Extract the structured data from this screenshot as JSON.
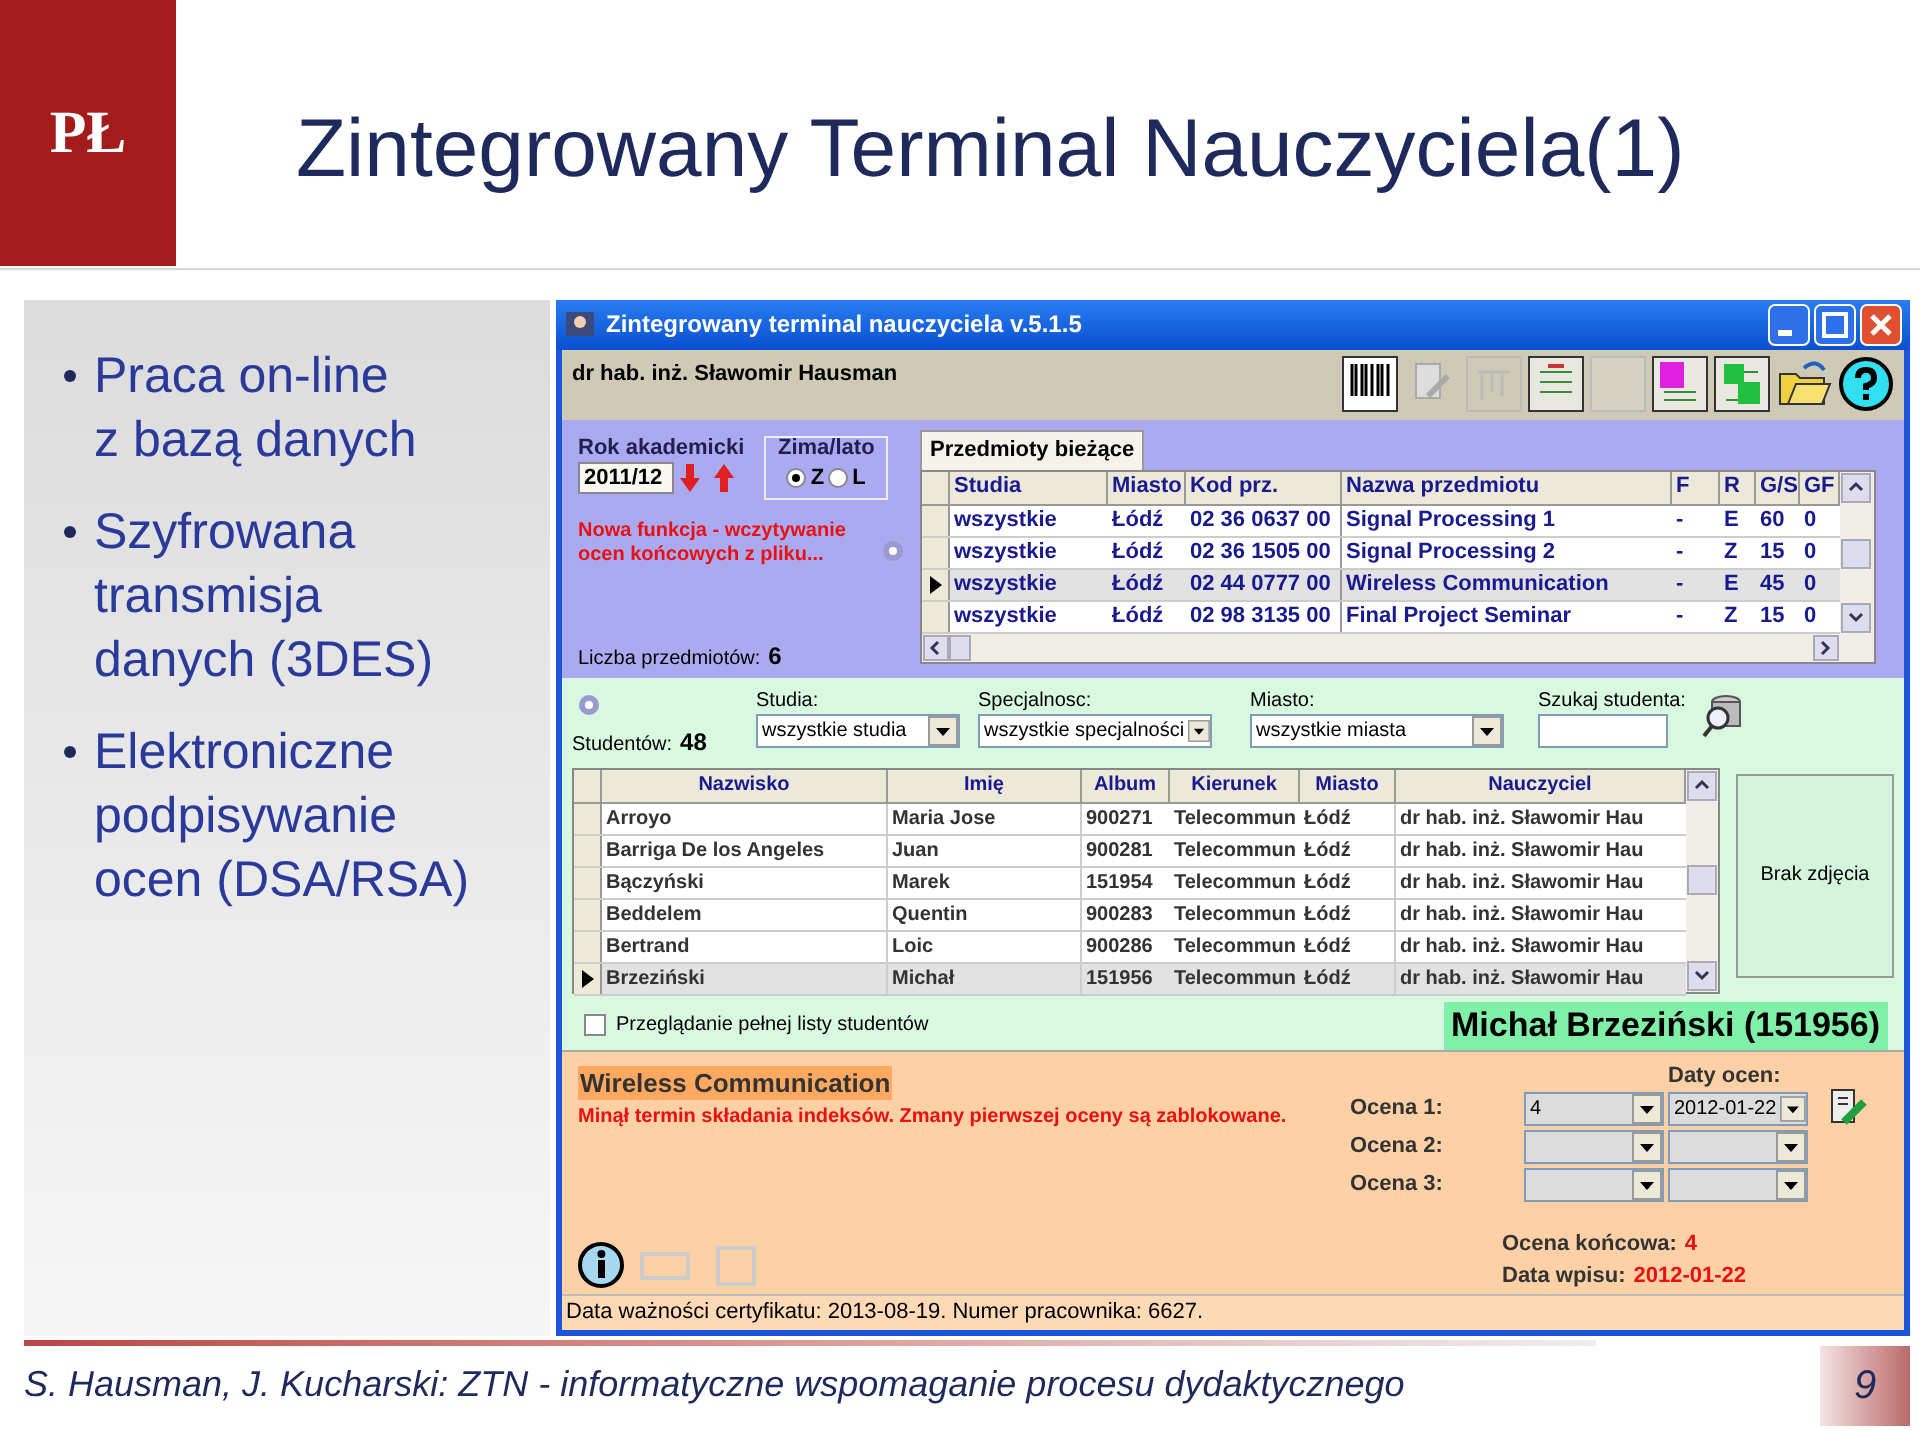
{
  "slide": {
    "logo_text": "PŁ",
    "title": "Zintegrowany Terminal Nauczyciela(1)",
    "bullets": [
      {
        "lines": [
          "Praca on-line",
          "z bazą danych"
        ]
      },
      {
        "lines": [
          "Szyfrowana",
          "transmisja",
          "danych (3DES)"
        ]
      },
      {
        "lines": [
          "Elektroniczne",
          "podpisywanie",
          "ocen (DSA/RSA)"
        ]
      }
    ],
    "footer": "S. Hausman, J. Kucharski: ZTN - informatyczne wspomaganie procesu dydaktycznego",
    "page_number": "9"
  },
  "app": {
    "window": {
      "title": "Zintegrowany terminal nauczyciela v.5.1.5"
    },
    "user_name": "dr hab. inż. Sławomir Hausman",
    "academic_year": {
      "label": "Rok akademicki",
      "value": "2011/12"
    },
    "semester": {
      "label": "Zima/lato",
      "options": [
        {
          "label": "Z",
          "selected": true
        },
        {
          "label": "L",
          "selected": false
        }
      ]
    },
    "notice": "Nowa funkcja - wczytywanie ocen końcowych z pliku...",
    "subjects_count": {
      "label": "Liczba przedmiotów:",
      "value": "6"
    },
    "tabs": [
      {
        "label": "Przedmioty bieżące",
        "selected": true
      }
    ],
    "subjects": {
      "columns": [
        "Studia",
        "Miasto",
        "Kod prz.",
        "Nazwa przedmiotu",
        "F",
        "R",
        "G/S",
        "GF"
      ],
      "rows": [
        {
          "selected": false,
          "cells": [
            "wszystkie",
            "Łódź",
            "02 36 0637 00",
            "Signal Processing 1",
            "-",
            "E",
            "60",
            "0"
          ]
        },
        {
          "selected": false,
          "cells": [
            "wszystkie",
            "Łódź",
            "02 36 1505 00",
            "Signal Processing 2",
            "-",
            "Z",
            "15",
            "0"
          ]
        },
        {
          "selected": true,
          "cells": [
            "wszystkie",
            "Łódź",
            "02 44 0777 00",
            "Wireless Communication",
            "-",
            "E",
            "45",
            "0"
          ]
        },
        {
          "selected": false,
          "cells": [
            "wszystkie",
            "Łódź",
            "02 98 3135 00",
            "Final Project Seminar",
            "-",
            "Z",
            "15",
            "0"
          ]
        }
      ]
    },
    "filters": [
      {
        "label": "Studia:",
        "value": "wszystkie studia"
      },
      {
        "label": "Specjalnosc:",
        "value": "wszystkie specjalności"
      },
      {
        "label": "Miasto:",
        "value": "wszystkie miasta"
      }
    ],
    "search": {
      "label": "Szukaj studenta:"
    },
    "students_count": {
      "label": "Studentów:",
      "value": "48"
    },
    "students": {
      "columns": [
        "Nazwisko",
        "Imię",
        "Album",
        "Kierunek",
        "Miasto",
        "Nauczyciel"
      ],
      "rows": [
        {
          "selected": false,
          "cells": [
            "Arroyo",
            "Maria Jose",
            "900271",
            "Telecommun",
            "Łódź",
            "dr hab. inż.  Sławomir Hau"
          ]
        },
        {
          "selected": false,
          "cells": [
            "Barriga De los Angeles",
            "Juan",
            "900281",
            "Telecommun",
            "Łódź",
            "dr hab. inż.  Sławomir Hau"
          ]
        },
        {
          "selected": false,
          "cells": [
            "Bączyński",
            "Marek",
            "151954",
            "Telecommun",
            "Łódź",
            "dr hab. inż.  Sławomir Hau"
          ]
        },
        {
          "selected": false,
          "cells": [
            "Beddelem",
            "Quentin",
            "900283",
            "Telecommun",
            "Łódź",
            "dr hab. inż.  Sławomir Hau"
          ]
        },
        {
          "selected": false,
          "cells": [
            "Bertrand",
            "Loic",
            "900286",
            "Telecommun",
            "Łódź",
            "dr hab. inż.  Sławomir Hau"
          ]
        },
        {
          "selected": true,
          "cells": [
            "Brzeziński",
            "Michał",
            "151956",
            "Telecommun",
            "Łódź",
            "dr hab. inż.  Sławomir Hau"
          ]
        }
      ]
    },
    "photo_text": "Brak zdjęcia",
    "full_list": {
      "label": "Przeglądanie pełnej listy studentów",
      "checked": false
    },
    "student_name": "Michał Brzeziński (151956)",
    "subject_title": "Wireless Communication",
    "warning": "Minął termin składania indeksów. Zmany pierwszej oceny są zablokowane.",
    "dates_label": "Daty ocen:",
    "grades": [
      {
        "label": "Ocena 1:",
        "value": "4",
        "date": "2012-01-22"
      },
      {
        "label": "Ocena 2:"
      },
      {
        "label": "Ocena 3:"
      }
    ],
    "final_grade": {
      "label": "Ocena końcowa:",
      "value": "4"
    },
    "entry_date": {
      "label": "Data wpisu:",
      "value": "2012-01-22"
    },
    "status": "Data ważności certyfikatu: 2013-08-19. Numer pracownika: 6627."
  }
}
